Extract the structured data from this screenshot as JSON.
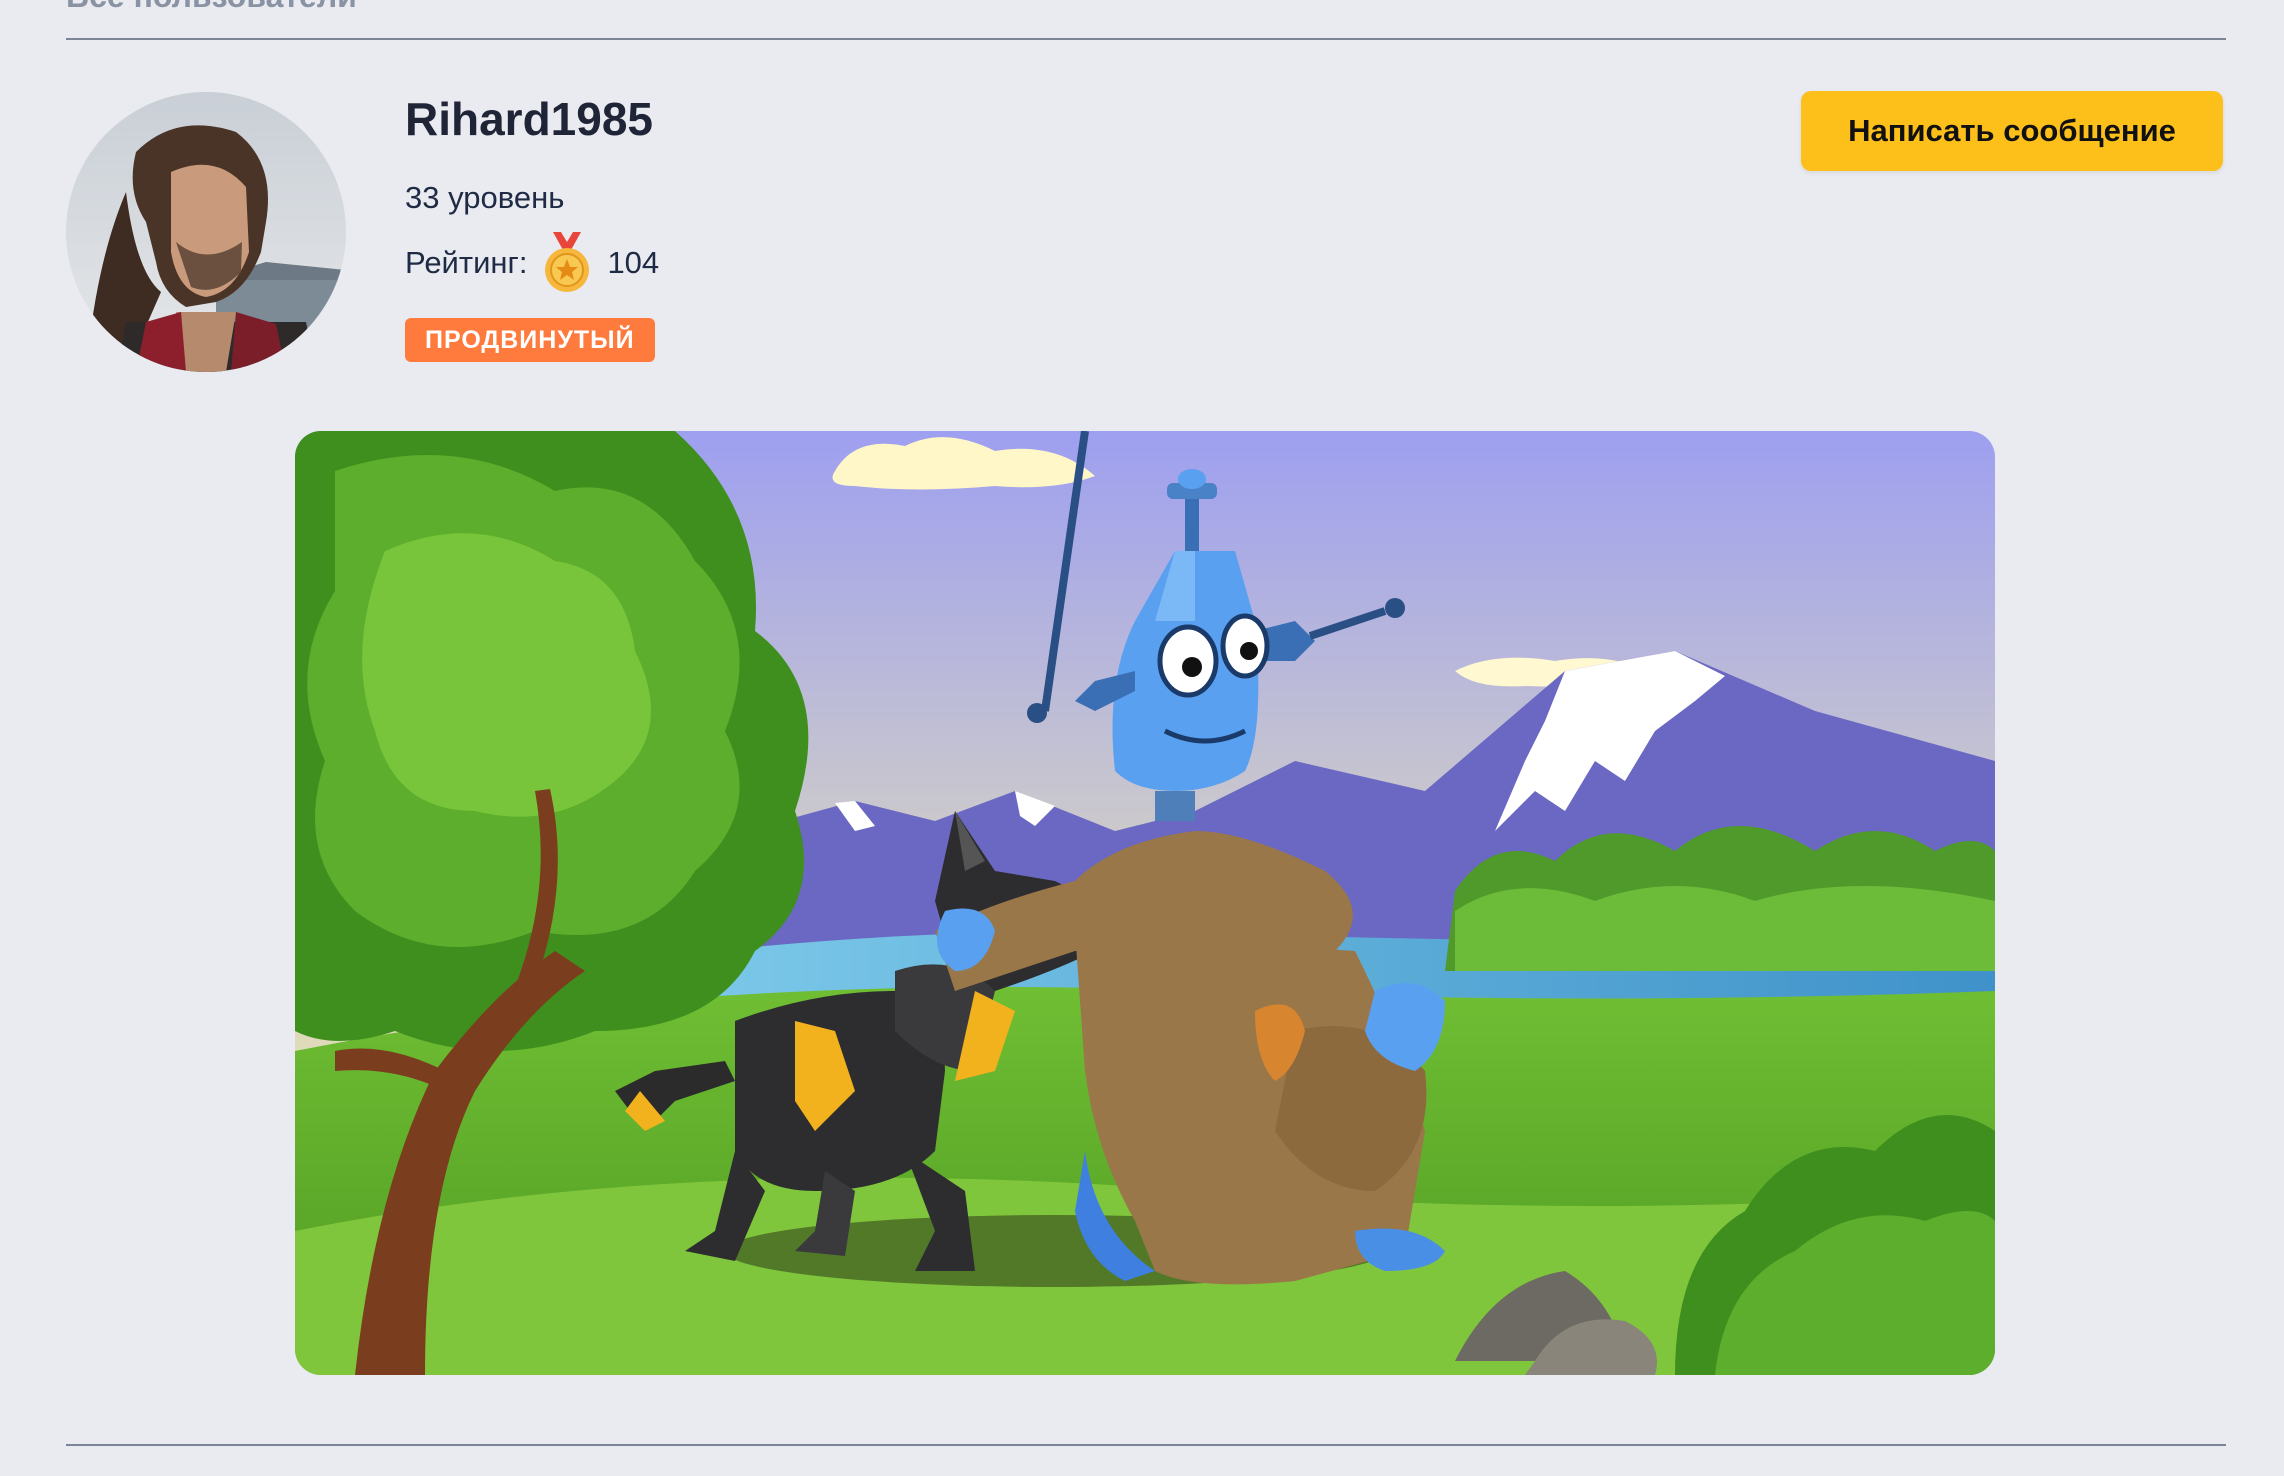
{
  "header": {
    "back_link": "Все пользователи"
  },
  "profile": {
    "username": "Rihard1985",
    "level_text": "33 уровень",
    "rating_label": "Рейтинг:",
    "rating_value": "104",
    "rank_badge": "ПРОДВИНУТЫЙ"
  },
  "actions": {
    "message_button": "Написать сообщение"
  },
  "colors": {
    "background": "#e9ebf0",
    "accent_button": "#fdc01b",
    "badge": "#ff7a3d"
  },
  "icons": {
    "rating": "medal-icon"
  }
}
